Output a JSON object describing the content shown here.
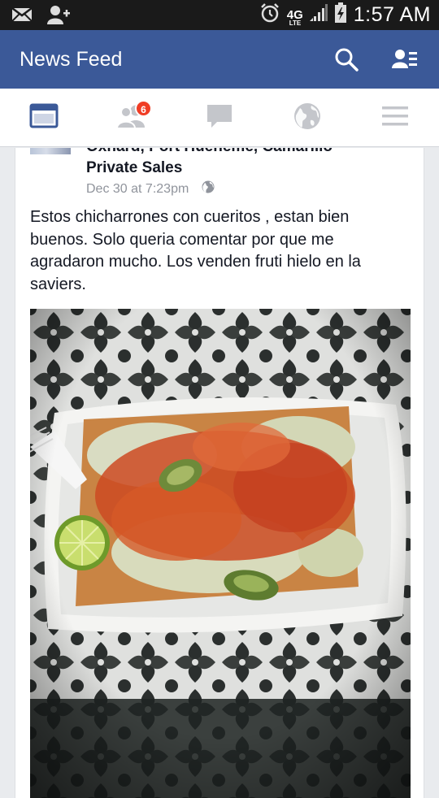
{
  "status_bar": {
    "time": "1:57 AM",
    "network": "4G",
    "network_sub": "LTE",
    "icons": [
      "mail-icon",
      "add-friend-icon",
      "alarm-icon",
      "signal-icon",
      "battery-icon"
    ]
  },
  "app_bar": {
    "title": "News Feed",
    "icons": [
      "search-icon",
      "friends-list-icon"
    ],
    "color": "#3b5998"
  },
  "tabs": [
    {
      "name": "news-feed",
      "icon": "news-feed-icon",
      "active": true
    },
    {
      "name": "friend-requests",
      "icon": "friend-requests-icon",
      "badge": "6"
    },
    {
      "name": "messages",
      "icon": "messages-icon"
    },
    {
      "name": "notifications",
      "icon": "globe-icon"
    },
    {
      "name": "more",
      "icon": "menu-icon"
    }
  ],
  "post": {
    "group_name_partial": "Oxnard, Port Hueneme, Camarillo",
    "group_name": "Private Sales",
    "timestamp": "Dec 30 at 7:23pm",
    "privacy_icon": "globe-icon",
    "text": "Estos chicharrones con cueritos , estan bien buenos. Solo queria comentar por que me agradaron mucho. Los venden fruti hielo en la saviers."
  }
}
